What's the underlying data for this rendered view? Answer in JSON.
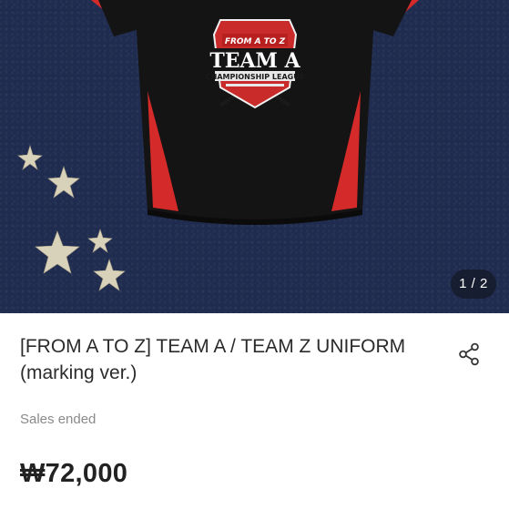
{
  "gallery": {
    "image_counter": "1 / 2",
    "badge": {
      "top_line": "FROM A TO Z",
      "main_line": "TEAM A",
      "sub_line": "CHAMPIONSHIP LEAGUE"
    }
  },
  "product": {
    "title_line1": "[FROM A TO Z] TEAM A / TEAM Z UNIFORM",
    "title_line2": "(marking ver.)",
    "status": "Sales ended",
    "price": "₩72,000"
  },
  "icons": {
    "share": "share-icon"
  },
  "colors": {
    "background_navy": "#1f2c4f",
    "jersey_black": "#141414",
    "jersey_red": "#d42a2a"
  }
}
